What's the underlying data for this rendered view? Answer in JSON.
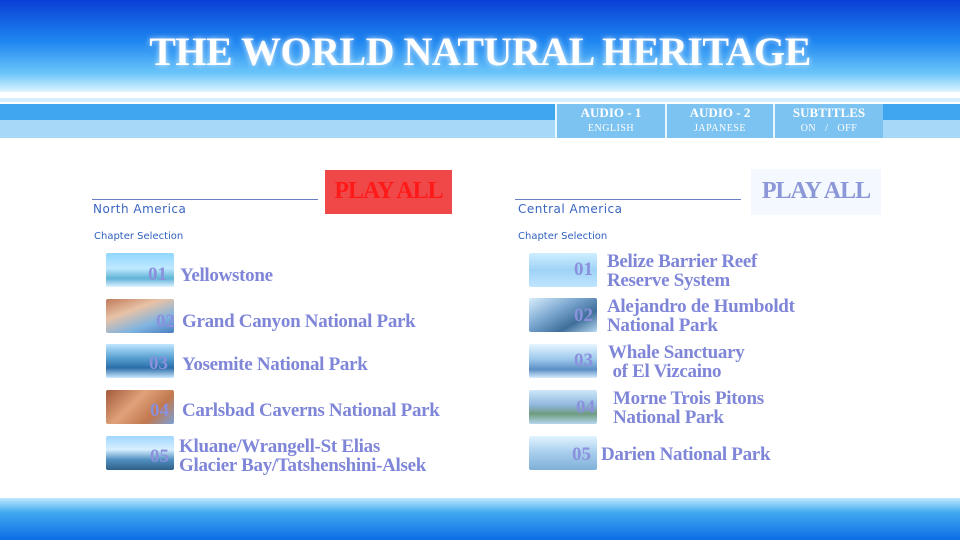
{
  "header": {
    "title": "THE WORLD NATURAL HERITAGE"
  },
  "audio_menu": [
    {
      "label": "AUDIO - 1",
      "sub": "ENGLISH"
    },
    {
      "label": "AUDIO - 2",
      "sub": "JAPANESE"
    },
    {
      "label": "SUBTITLES",
      "sub": "ON   /   OFF"
    }
  ],
  "left": {
    "region": "North America",
    "play_all": "PLAY ALL",
    "chapter_selection": "Chapter Selection",
    "chapters": [
      {
        "num": "01",
        "line1": "Yellowstone",
        "line2": ""
      },
      {
        "num": "02",
        "line1": "Grand Canyon National Park",
        "line2": ""
      },
      {
        "num": "03",
        "line1": "Yosemite National Park",
        "line2": ""
      },
      {
        "num": "04",
        "line1": "Carlsbad Caverns National Park",
        "line2": ""
      },
      {
        "num": "05",
        "line1": "Kluane/Wrangell-St Elias",
        "line2": "Glacier Bay/Tatshenshini-Alsek"
      }
    ]
  },
  "right": {
    "region": "Central America",
    "play_all": "PLAY ALL",
    "chapter_selection": "Chapter Selection",
    "chapters": [
      {
        "num": "01",
        "line1": "Belize Barrier Reef",
        "line2": "Reserve System"
      },
      {
        "num": "02",
        "line1": "Alejandro de Humboldt",
        "line2": "National Park"
      },
      {
        "num": "03",
        "line1": "Whale Sanctuary",
        "line2": " of El Vizcaino"
      },
      {
        "num": "04",
        "line1": "Morne Trois Pitons",
        "line2": "National Park"
      },
      {
        "num": "05",
        "line1": "Darien National Park",
        "line2": ""
      }
    ]
  },
  "colors": {
    "play_all_selected_bg": "#f04848",
    "chapter_text": "#7f86d8",
    "header_blue": "#0a3fd6"
  }
}
